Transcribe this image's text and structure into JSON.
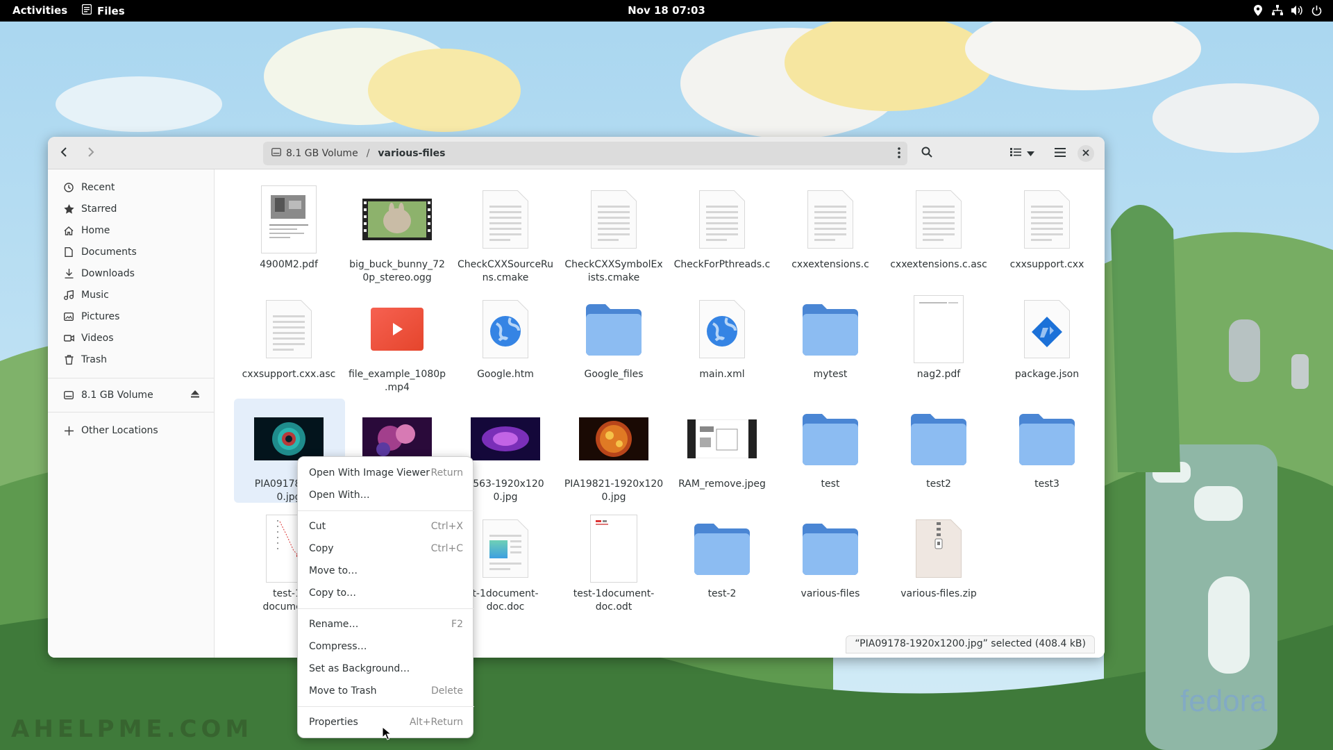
{
  "topbar": {
    "activities": "Activities",
    "app_name": "Files",
    "clock": "Nov 18  07:03",
    "tray_icons": [
      "location-icon",
      "network-icon",
      "volume-icon",
      "power-icon"
    ]
  },
  "window": {
    "pathbar": {
      "volume_label": "8.1 GB Volume",
      "separator": "/",
      "folder_label": "various-files"
    }
  },
  "sidebar": {
    "items": [
      {
        "label": "Recent",
        "icon": "clock-icon"
      },
      {
        "label": "Starred",
        "icon": "star-icon"
      },
      {
        "label": "Home",
        "icon": "home-icon"
      },
      {
        "label": "Documents",
        "icon": "document-icon"
      },
      {
        "label": "Downloads",
        "icon": "download-icon"
      },
      {
        "label": "Music",
        "icon": "music-icon"
      },
      {
        "label": "Pictures",
        "icon": "picture-icon"
      },
      {
        "label": "Videos",
        "icon": "video-icon"
      },
      {
        "label": "Trash",
        "icon": "trash-icon"
      }
    ],
    "volume": {
      "label": "8.1 GB Volume",
      "icon": "drive-icon"
    },
    "other_locations": {
      "label": "Other Locations",
      "icon": "plus-icon"
    }
  },
  "files": [
    {
      "name": "4900M2.pdf",
      "kind": "pdf-thumb"
    },
    {
      "name": "big_buck_bunny_720p_stereo.ogg",
      "kind": "video-thumb"
    },
    {
      "name": "CheckCXXSourceRuns.cmake",
      "kind": "text"
    },
    {
      "name": "CheckCXXSymbolExists.cmake",
      "kind": "text"
    },
    {
      "name": "CheckForPthreads.c",
      "kind": "text"
    },
    {
      "name": "cxxextensions.c",
      "kind": "text"
    },
    {
      "name": "cxxextensions.c.asc",
      "kind": "text"
    },
    {
      "name": "cxxsupport.cxx",
      "kind": "text"
    },
    {
      "name": "cxxsupport.cxx.asc",
      "kind": "text"
    },
    {
      "name": "file_example_1080p.mp4",
      "kind": "video"
    },
    {
      "name": "Google.htm",
      "kind": "web"
    },
    {
      "name": "Google_files",
      "kind": "folder"
    },
    {
      "name": "main.xml",
      "kind": "web"
    },
    {
      "name": "mytest",
      "kind": "folder"
    },
    {
      "name": "nag2.pdf",
      "kind": "pdf-blank"
    },
    {
      "name": "package.json",
      "kind": "json"
    },
    {
      "name": "PIA09178-1920x1200.jpg",
      "kind": "image-nebula"
    },
    {
      "name": "",
      "kind": "image-galaxy"
    },
    {
      "name": "7563-1920x1200.jpg",
      "kind": "image-purple"
    },
    {
      "name": "PIA19821-1920x1200.jpg",
      "kind": "image-sun"
    },
    {
      "name": "RAM_remove.jpeg",
      "kind": "image-ram"
    },
    {
      "name": "test",
      "kind": "folder"
    },
    {
      "name": "test2",
      "kind": "folder"
    },
    {
      "name": "test3",
      "kind": "folder"
    },
    {
      "name": "test-1-document.",
      "kind": "doc-chart"
    },
    {
      "name": "",
      "kind": "hidden"
    },
    {
      "name": "t-1document-doc.doc",
      "kind": "doc-img"
    },
    {
      "name": "test-1document-doc.odt",
      "kind": "doc-odt"
    },
    {
      "name": "test-2",
      "kind": "folder"
    },
    {
      "name": "various-files",
      "kind": "folder"
    },
    {
      "name": "various-files.zip",
      "kind": "zip"
    }
  ],
  "labels": {
    "f0": "4900M2.pdf",
    "f1a": "big_buck_bunny_72",
    "f1b": "0p_stereo.ogg",
    "f2a": "CheckCXXSourceRu",
    "f2b": "ns.cmake",
    "f3a": "CheckCXXSymbolEx",
    "f3b": "ists.cmake",
    "f4": "CheckForPthreads.c",
    "f5": "cxxextensions.c",
    "f6": "cxxextensions.c.asc",
    "f7": "cxxsupport.cxx",
    "f8": "cxxsupport.cxx.asc",
    "f9a": "file_example_1080p",
    "f9b": ".mp4",
    "f10": "Google.htm",
    "f11": "Google_files",
    "f12": "main.xml",
    "f13": "mytest",
    "f14": "nag2.pdf",
    "f15": "package.json",
    "f16a": "PIA09178-192",
    "f16b": "0.jpg",
    "f18a": "7563-1920x120",
    "f18b": "0.jpg",
    "f19a": "PIA19821-1920x120",
    "f19b": "0.jpg",
    "f20": "RAM_remove.jpeg",
    "f21": "test",
    "f22": "test2",
    "f23": "test3",
    "f24a": "test-1-",
    "f24b": "document.",
    "f26a": "t-1document-",
    "f26b": "doc.doc",
    "f27a": "test-1document-",
    "f27b": "doc.odt",
    "f28": "test-2",
    "f29": "various-files",
    "f30": "various-files.zip"
  },
  "status": "“PIA09178-1920x1200.jpg” selected (408.4 kB)",
  "context_menu": {
    "items": [
      {
        "label": "Open With Image Viewer",
        "accel": "Return"
      },
      {
        "label": "Open With…",
        "accel": ""
      },
      {
        "label": "Cut",
        "accel": "Ctrl+X"
      },
      {
        "label": "Copy",
        "accel": "Ctrl+C"
      },
      {
        "label": "Move to…",
        "accel": ""
      },
      {
        "label": "Copy to…",
        "accel": ""
      },
      {
        "label": "Rename…",
        "accel": "F2"
      },
      {
        "label": "Compress…",
        "accel": ""
      },
      {
        "label": "Set as Background…",
        "accel": ""
      },
      {
        "label": "Move to Trash",
        "accel": "Delete"
      },
      {
        "label": "Properties",
        "accel": "Alt+Return"
      }
    ]
  },
  "wallpaper": {
    "watermark": "AHELPME.COM",
    "logo": "fedora"
  },
  "colors": {
    "folder": "#62a0ea",
    "folder_dark": "#4a86d4",
    "selection": "#e4eefa",
    "topbar": "#000000"
  }
}
